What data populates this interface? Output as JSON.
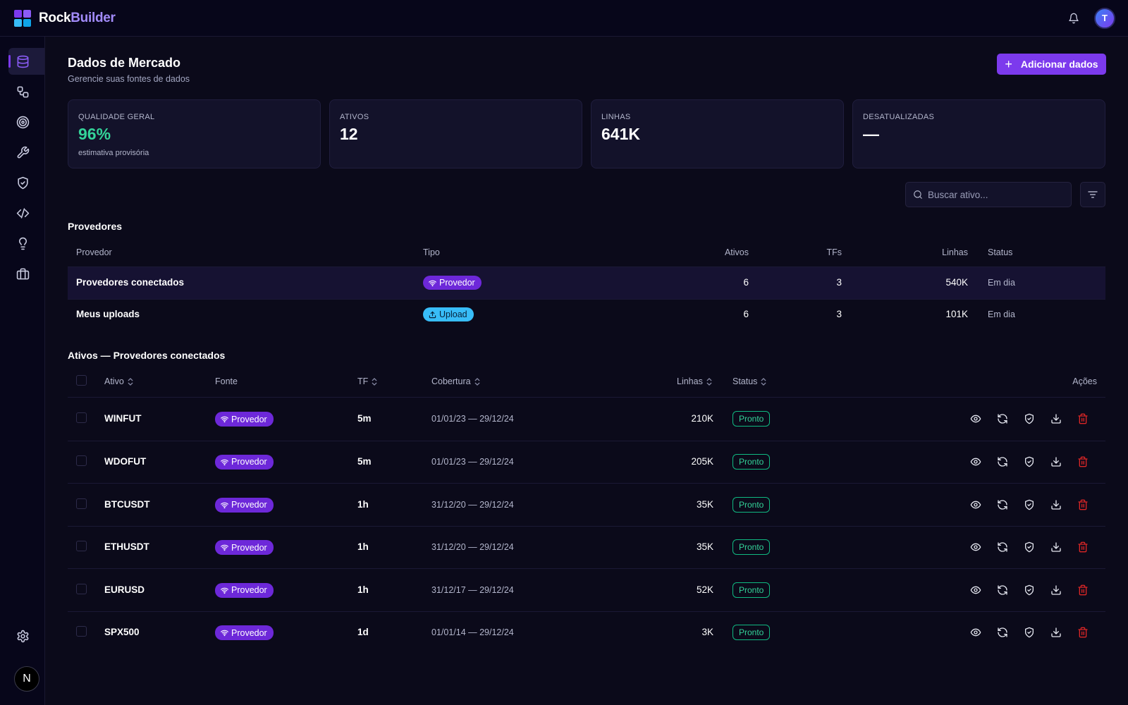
{
  "app": {
    "brand_part1": "Rock",
    "brand_part2": "Builder",
    "avatar_initial": "T"
  },
  "sidebar": {
    "items": [
      {
        "icon": "database-icon",
        "active": true
      },
      {
        "icon": "workflow-icon",
        "active": false
      },
      {
        "icon": "target-icon",
        "active": false
      },
      {
        "icon": "wrench-icon",
        "active": false
      },
      {
        "icon": "shield-check-icon",
        "active": false
      },
      {
        "icon": "code-icon",
        "active": false
      },
      {
        "icon": "lightbulb-icon",
        "active": false
      },
      {
        "icon": "briefcase-icon",
        "active": false
      }
    ],
    "bottom": [
      "gear-icon",
      "n-logo-icon"
    ],
    "n_logo": "N"
  },
  "page": {
    "title": "Dados de Mercado",
    "subtitle": "Gerencie suas fontes de dados",
    "add_button": "Adicionar dados"
  },
  "stats": [
    {
      "label": "QUALIDADE GERAL",
      "value": "96%",
      "sub": "estimativa provisória",
      "color": "#34d399"
    },
    {
      "label": "ATIVOS",
      "value": "12",
      "sub": "",
      "color": "#ffffff"
    },
    {
      "label": "LINHAS",
      "value": "641K",
      "sub": "",
      "color": "#ffffff"
    },
    {
      "label": "DESATUALIZADAS",
      "value": "—",
      "sub": "",
      "color": "#ffffff"
    }
  ],
  "search": {
    "placeholder": "Buscar ativo..."
  },
  "providers": {
    "title": "Provedores",
    "headers": {
      "provedor": "Provedor",
      "tipo": "Tipo",
      "ativos": "Ativos",
      "tfs": "TFs",
      "linhas": "Linhas",
      "status": "Status"
    },
    "rows": [
      {
        "name": "Provedores conectados",
        "type": "Provedor",
        "type_kind": "provider",
        "ativos": "6",
        "tfs": "3",
        "linhas": "540K",
        "status": "Em dia"
      },
      {
        "name": "Meus uploads",
        "type": "Upload",
        "type_kind": "upload",
        "ativos": "6",
        "tfs": "3",
        "linhas": "101K",
        "status": "Em dia"
      }
    ]
  },
  "assets": {
    "title": "Ativos — Provedores conectados",
    "headers": {
      "ativo": "Ativo",
      "fonte": "Fonte",
      "tf": "TF",
      "cobertura": "Cobertura",
      "linhas": "Linhas",
      "status": "Status",
      "acoes": "Ações"
    },
    "rows": [
      {
        "ativo": "WINFUT",
        "fonte": "Provedor",
        "tf": "5m",
        "cobertura": "01/01/23 — 29/12/24",
        "linhas": "210K",
        "status": "Pronto"
      },
      {
        "ativo": "WDOFUT",
        "fonte": "Provedor",
        "tf": "5m",
        "cobertura": "01/01/23 — 29/12/24",
        "linhas": "205K",
        "status": "Pronto"
      },
      {
        "ativo": "BTCUSDT",
        "fonte": "Provedor",
        "tf": "1h",
        "cobertura": "31/12/20 — 29/12/24",
        "linhas": "35K",
        "status": "Pronto"
      },
      {
        "ativo": "ETHUSDT",
        "fonte": "Provedor",
        "tf": "1h",
        "cobertura": "31/12/20 — 29/12/24",
        "linhas": "35K",
        "status": "Pronto"
      },
      {
        "ativo": "EURUSD",
        "fonte": "Provedor",
        "tf": "1h",
        "cobertura": "31/12/17 — 29/12/24",
        "linhas": "52K",
        "status": "Pronto"
      },
      {
        "ativo": "SPX500",
        "fonte": "Provedor",
        "tf": "1d",
        "cobertura": "01/01/14 — 29/12/24",
        "linhas": "3K",
        "status": "Pronto"
      }
    ],
    "action_icons": [
      "eye-icon",
      "refresh-icon",
      "shield-check-icon",
      "download-icon",
      "trash-icon"
    ]
  },
  "colors": {
    "accent": "#7c3aed",
    "provider_pill": "#6d28d9",
    "upload_pill": "#38bdf8",
    "success": "#34d399",
    "danger": "#dc2626"
  }
}
